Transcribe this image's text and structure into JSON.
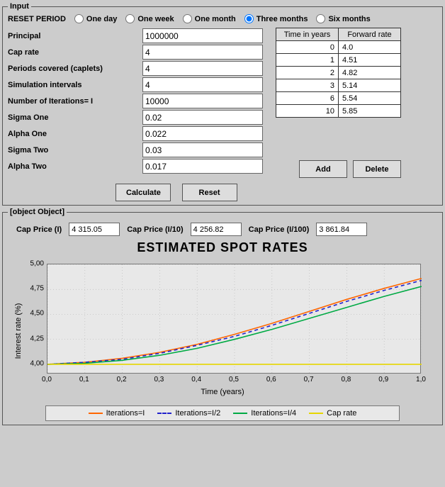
{
  "input": {
    "legend": "Input",
    "reset_label": "RESET PERIOD",
    "reset_options": {
      "one_day": "One day",
      "one_week": "One week",
      "one_month": "One month",
      "three_months": "Three months",
      "six_months": "Six months"
    },
    "reset_selected": "three_months",
    "params": {
      "principal_label": "Principal",
      "principal_value": "1000000",
      "cap_rate_label": "Cap rate",
      "cap_rate_value": "4",
      "periods_label": "Periods covered (caplets)",
      "periods_value": "4",
      "sim_intervals_label": "Simulation intervals",
      "sim_intervals_value": "4",
      "iterations_label": "Number of Iterations= I",
      "iterations_value": "10000",
      "sigma_one_label": "Sigma One",
      "sigma_one_value": "0.02",
      "alpha_one_label": "Alpha One",
      "alpha_one_value": "0.022",
      "sigma_two_label": "Sigma Two",
      "sigma_two_value": "0.03",
      "alpha_two_label": "Alpha Two",
      "alpha_two_value": "0.017"
    },
    "fwd": {
      "header_time": "Time in years",
      "header_rate": "Forward rate",
      "rows": [
        {
          "t": "0",
          "r": "4.0"
        },
        {
          "t": "1",
          "r": "4.51"
        },
        {
          "t": "2",
          "r": "4.82"
        },
        {
          "t": "3",
          "r": "5.14"
        },
        {
          "t": "6",
          "r": "5.54"
        },
        {
          "t": "10",
          "r": "5.85"
        }
      ],
      "add_label": "Add",
      "delete_label": "Delete"
    },
    "calculate_label": "Calculate",
    "reset_btn_label": "Reset"
  },
  "output": {
    "legend": {
      "iter_I": "Iterations=I",
      "iter_I2": "Iterations=I/2",
      "iter_I4": "Iterations=I/4",
      "cap": "Cap rate"
    },
    "price_I_label": "Cap Price (I)",
    "price_I_value": "4 315.05",
    "price_I10_label": "Cap Price (I/10)",
    "price_I10_value": "4 256.82",
    "price_I100_label": "Cap Price (I/100)",
    "price_I100_value": "3 861.84",
    "chart_title": "ESTIMATED SPOT RATES",
    "xlabel": "Time (years)",
    "ylabel": "Interest rate (%)"
  },
  "chart_data": {
    "type": "line",
    "title": "ESTIMATED SPOT RATES",
    "xlabel": "Time (years)",
    "ylabel": "Interest rate (%)",
    "xlim": [
      0.0,
      1.0
    ],
    "ylim": [
      3.9,
      5.0
    ],
    "x_ticks": [
      "0,0",
      "0,1",
      "0,2",
      "0,3",
      "0,4",
      "0,5",
      "0,6",
      "0,7",
      "0,8",
      "0,9",
      "1,0"
    ],
    "y_ticks": [
      "4,00",
      "4,25",
      "4,50",
      "4,75",
      "5,00"
    ],
    "x": [
      0.0,
      0.1,
      0.2,
      0.3,
      0.4,
      0.5,
      0.6,
      0.7,
      0.8,
      0.9,
      1.0
    ],
    "series": [
      {
        "name": "Iterations=I",
        "color": "#ff6600",
        "values": [
          4.0,
          4.02,
          4.06,
          4.12,
          4.2,
          4.3,
          4.41,
          4.53,
          4.65,
          4.76,
          4.86
        ]
      },
      {
        "name": "Iterations=I/2",
        "color": "#2222cc",
        "style": "dashed",
        "values": [
          4.0,
          4.02,
          4.05,
          4.11,
          4.19,
          4.28,
          4.39,
          4.51,
          4.63,
          4.74,
          4.84
        ]
      },
      {
        "name": "Iterations=I/4",
        "color": "#00aa44",
        "values": [
          4.0,
          4.01,
          4.04,
          4.09,
          4.16,
          4.25,
          4.35,
          4.46,
          4.57,
          4.68,
          4.78
        ]
      },
      {
        "name": "Cap rate",
        "color": "#e6d600",
        "values": [
          4.0,
          4.0,
          4.0,
          4.0,
          4.0,
          4.0,
          4.0,
          4.0,
          4.0,
          4.0,
          4.0
        ]
      }
    ]
  }
}
